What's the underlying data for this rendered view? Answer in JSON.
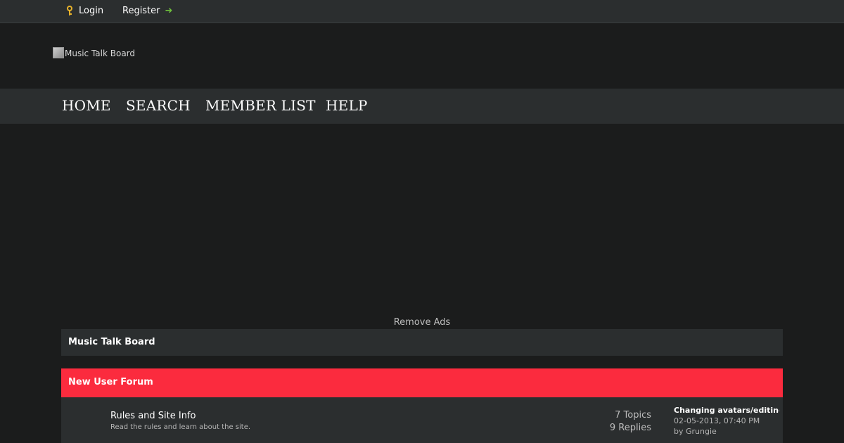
{
  "topbar": {
    "login_label": "Login",
    "register_label": "Register",
    "login_icon": "key-icon",
    "register_icon": "arrow-right-icon"
  },
  "header": {
    "logo_alt": "Music Talk Board"
  },
  "nav": {
    "items": [
      {
        "label": "HOME"
      },
      {
        "label": "SEARCH"
      },
      {
        "label": "MEMBER LIST"
      },
      {
        "label": "HELP"
      }
    ]
  },
  "ads": {
    "remove_label": "Remove Ads"
  },
  "breadcrumb": {
    "label": "Music Talk Board"
  },
  "category": {
    "title": "New User Forum",
    "color": "#fb2b3e"
  },
  "forums": [
    {
      "name": "Rules and Site Info",
      "description": "Read the rules and learn about the site.",
      "topics": "7 Topics",
      "replies": "9 Replies",
      "last_post": {
        "title": "Changing avatars/editing ...",
        "date": "02-05-2013, 07:40 PM",
        "by_prefix": "by",
        "author": "Grungie"
      }
    }
  ],
  "colors": {
    "background": "#1b1c1c",
    "panel": "#2b2e2f",
    "accent_red": "#fb2b3e",
    "key_icon": "#e8b22a",
    "arrow_icon": "#6ec03c"
  }
}
